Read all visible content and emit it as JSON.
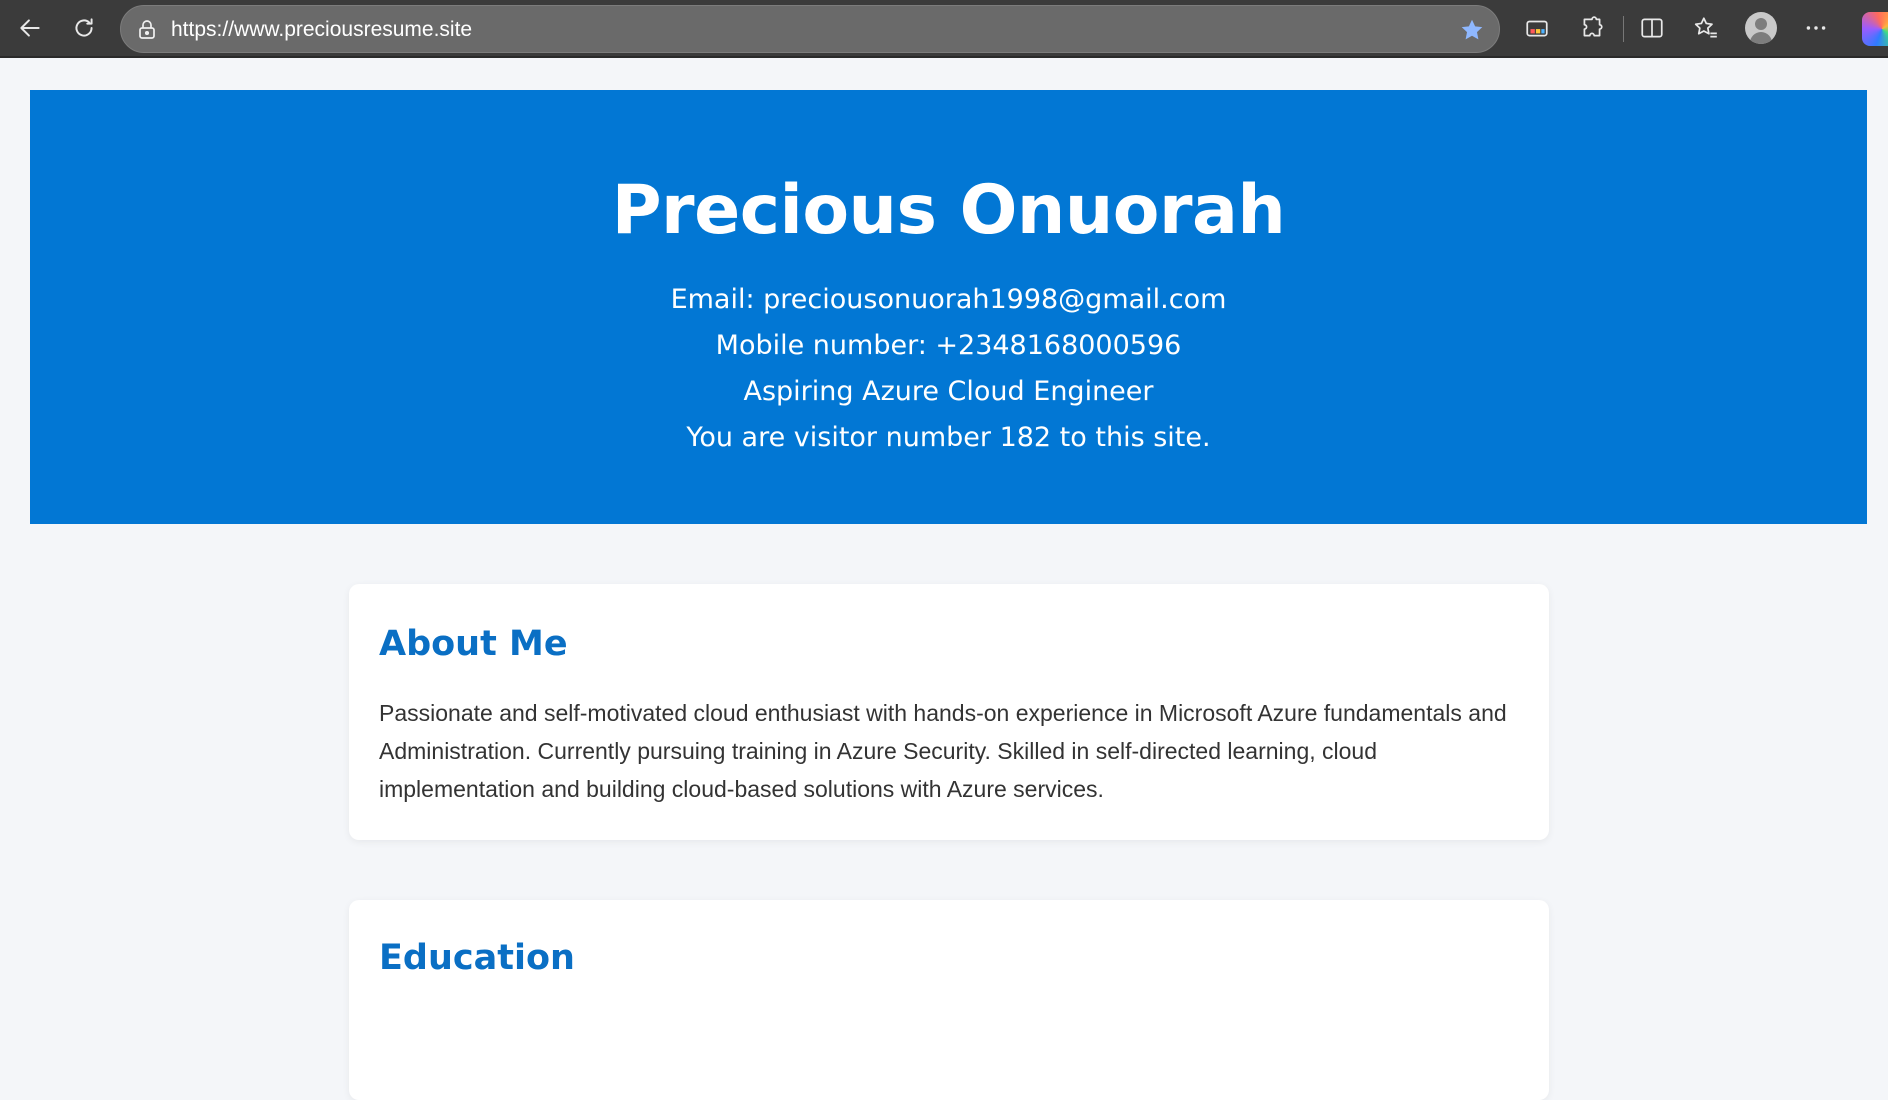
{
  "browser": {
    "url": "https://www.preciousresume.site",
    "icons": [
      "back-arrow-icon",
      "refresh-icon",
      "lock-icon",
      "favorite-star-icon",
      "media-cast-icon",
      "extensions-icon",
      "split-screen-icon",
      "favorites-icon",
      "profile-avatar-icon",
      "more-options-icon",
      "copilot-icon"
    ]
  },
  "hero": {
    "name": "Precious Onuorah",
    "email_line": "Email: preciousonuorah1998@gmail.com",
    "mobile_line": "Mobile number: +2348168000596",
    "role_line": "Aspiring Azure Cloud Engineer",
    "visitor_line": "You are visitor number 182 to this site."
  },
  "sections": {
    "about": {
      "title": "About Me",
      "body": "Passionate and self-motivated cloud enthusiast with hands-on experience in Microsoft Azure fundamentals and Administration. Currently pursuing training in Azure Security. Skilled in self-directed learning, cloud implementation and building cloud-based solutions with Azure services."
    },
    "education": {
      "title": "Education"
    }
  },
  "colors": {
    "hero_bg": "#0277d4",
    "heading_accent": "#0a6fc4",
    "page_bg": "#f4f6f9"
  }
}
